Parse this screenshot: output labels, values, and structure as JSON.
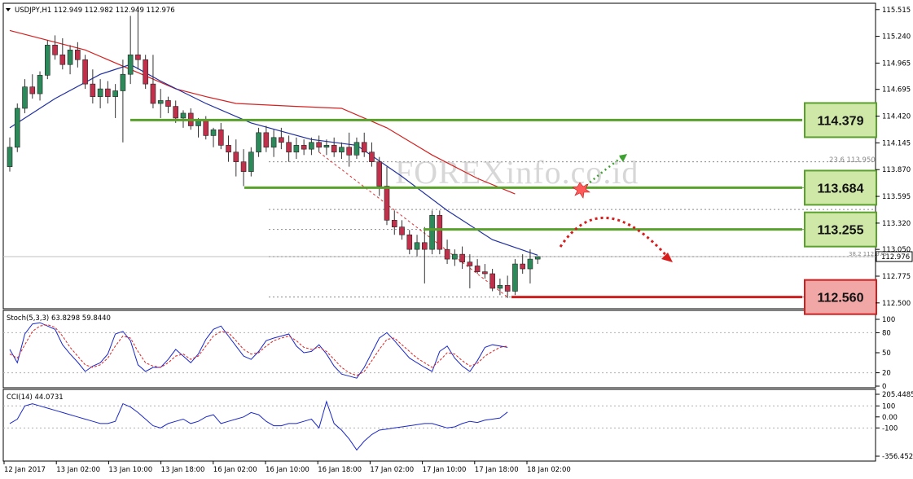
{
  "chart_data": {
    "type": "candlestick",
    "symbol_header": "USDJPY,H1  112.949 112.982 112.949 112.976",
    "price_axis": {
      "ticks": [
        "115.515",
        "115.240",
        "114.965",
        "114.695",
        "114.420",
        "114.145",
        "113.870",
        "113.595",
        "113.320",
        "113.050",
        "112.775",
        "112.500"
      ],
      "min": 112.44,
      "max": 115.58,
      "current_price": "112.976"
    },
    "time_labels": [
      "12 Jan 2017",
      "13 Jan 02:00",
      "13 Jan 10:00",
      "13 Jan 18:00",
      "16 Jan 02:00",
      "16 Jan 10:00",
      "16 Jan 18:00",
      "17 Jan 02:00",
      "17 Jan 10:00",
      "17 Jan 18:00",
      "18 Jan 02:00"
    ],
    "candles": [
      [
        113.9,
        114.2,
        113.85,
        114.1
      ],
      [
        114.1,
        114.55,
        114.05,
        114.5
      ],
      [
        114.5,
        114.8,
        114.45,
        114.72
      ],
      [
        114.72,
        114.85,
        114.6,
        114.65
      ],
      [
        114.65,
        114.88,
        114.58,
        114.84
      ],
      [
        114.84,
        115.2,
        114.8,
        115.15
      ],
      [
        115.15,
        115.25,
        115.0,
        115.05
      ],
      [
        115.05,
        115.22,
        114.9,
        114.95
      ],
      [
        114.95,
        115.15,
        114.85,
        115.1
      ],
      [
        115.1,
        115.18,
        114.92,
        115.0
      ],
      [
        115.0,
        115.05,
        114.7,
        114.75
      ],
      [
        114.75,
        114.9,
        114.55,
        114.62
      ],
      [
        114.62,
        114.8,
        114.5,
        114.7
      ],
      [
        114.7,
        114.78,
        114.55,
        114.62
      ],
      [
        114.62,
        114.75,
        114.4,
        114.68
      ],
      [
        114.68,
        115.0,
        114.15,
        114.85
      ],
      [
        114.85,
        115.45,
        114.75,
        115.05
      ],
      [
        115.05,
        115.55,
        114.9,
        115.0
      ],
      [
        115.0,
        115.05,
        114.7,
        114.75
      ],
      [
        114.75,
        115.05,
        114.5,
        114.55
      ],
      [
        114.55,
        114.7,
        114.4,
        114.58
      ],
      [
        114.58,
        114.62,
        114.45,
        114.52
      ],
      [
        114.52,
        114.58,
        114.35,
        114.4
      ],
      [
        114.4,
        114.48,
        114.3,
        114.45
      ],
      [
        114.45,
        114.5,
        114.28,
        114.32
      ],
      [
        114.32,
        114.4,
        114.2,
        114.38
      ],
      [
        114.38,
        114.42,
        114.18,
        114.22
      ],
      [
        114.22,
        114.3,
        114.1,
        114.28
      ],
      [
        114.28,
        114.35,
        114.08,
        114.12
      ],
      [
        114.12,
        114.22,
        113.95,
        114.05
      ],
      [
        114.05,
        114.18,
        113.8,
        113.95
      ],
      [
        113.95,
        114.08,
        113.7,
        113.85
      ],
      [
        113.85,
        114.1,
        113.8,
        114.05
      ],
      [
        114.05,
        114.3,
        114.0,
        114.25
      ],
      [
        114.25,
        114.32,
        114.05,
        114.1
      ],
      [
        114.1,
        114.28,
        114.0,
        114.2
      ],
      [
        114.2,
        114.3,
        114.08,
        114.15
      ],
      [
        114.15,
        114.22,
        113.95,
        114.05
      ],
      [
        114.05,
        114.2,
        113.98,
        114.12
      ],
      [
        114.12,
        114.18,
        114.02,
        114.08
      ],
      [
        114.08,
        114.2,
        114.02,
        114.15
      ],
      [
        114.15,
        114.22,
        114.05,
        114.1
      ],
      [
        114.1,
        114.18,
        114.02,
        114.12
      ],
      [
        114.12,
        114.2,
        114.0,
        114.05
      ],
      [
        114.05,
        114.15,
        113.98,
        114.1
      ],
      [
        114.1,
        114.25,
        113.9,
        114.02
      ],
      [
        114.02,
        114.2,
        113.98,
        114.15
      ],
      [
        114.15,
        114.25,
        114.0,
        114.05
      ],
      [
        114.05,
        114.15,
        113.9,
        113.95
      ],
      [
        113.95,
        114.0,
        113.6,
        113.7
      ],
      [
        113.7,
        113.9,
        113.3,
        113.35
      ],
      [
        113.35,
        113.45,
        113.2,
        113.28
      ],
      [
        113.28,
        113.35,
        113.15,
        113.2
      ],
      [
        113.2,
        113.25,
        113.0,
        113.05
      ],
      [
        113.05,
        113.2,
        112.98,
        113.12
      ],
      [
        113.12,
        113.28,
        112.7,
        113.05
      ],
      [
        113.05,
        113.45,
        113.0,
        113.4
      ],
      [
        113.4,
        113.45,
        113.0,
        113.05
      ],
      [
        113.05,
        113.15,
        112.9,
        112.95
      ],
      [
        112.95,
        113.05,
        112.88,
        113.0
      ],
      [
        113.0,
        113.08,
        112.85,
        112.92
      ],
      [
        112.92,
        113.0,
        112.65,
        112.88
      ],
      [
        112.88,
        112.95,
        112.8,
        112.82
      ],
      [
        112.82,
        112.9,
        112.75,
        112.8
      ],
      [
        112.8,
        112.85,
        112.62,
        112.65
      ],
      [
        112.65,
        112.75,
        112.58,
        112.68
      ],
      [
        112.68,
        112.78,
        112.55,
        112.62
      ],
      [
        112.62,
        112.95,
        112.58,
        112.9
      ],
      [
        112.9,
        113.0,
        112.8,
        112.85
      ],
      [
        112.85,
        113.05,
        112.7,
        112.95
      ],
      [
        112.95,
        112.98,
        112.9,
        112.976
      ]
    ],
    "ma_slow": [
      [
        0,
        115.3
      ],
      [
        10,
        115.1
      ],
      [
        16,
        114.9
      ],
      [
        22,
        114.7
      ],
      [
        26,
        114.62
      ],
      [
        30,
        114.55
      ],
      [
        38,
        114.52
      ],
      [
        44,
        114.5
      ],
      [
        50,
        114.3
      ],
      [
        56,
        114.02
      ],
      [
        62,
        113.78
      ],
      [
        67,
        113.62
      ]
    ],
    "ma_fast": [
      [
        0,
        114.3
      ],
      [
        6,
        114.6
      ],
      [
        12,
        114.85
      ],
      [
        16,
        114.95
      ],
      [
        20,
        114.78
      ],
      [
        26,
        114.55
      ],
      [
        32,
        114.35
      ],
      [
        40,
        114.18
      ],
      [
        46,
        114.12
      ],
      [
        52,
        113.8
      ],
      [
        58,
        113.45
      ],
      [
        64,
        113.15
      ],
      [
        70,
        112.99
      ]
    ],
    "levels": [
      {
        "price": "114.379",
        "role": "resistance",
        "color": "#7bb040"
      },
      {
        "price": "113.684",
        "role": "resistance",
        "color": "#7bb040"
      },
      {
        "price": "113.255",
        "role": "resistance",
        "color": "#7bb040"
      },
      {
        "price": "112.560",
        "role": "support",
        "color": "#d9534f"
      }
    ],
    "fib_label": "23.6  113.950",
    "fib_small_label": "38.2  112.975",
    "watermark": "FOREXinfo.co.id",
    "stochastic": {
      "label": "Stoch(5,3,3) 63.8298 59.8440",
      "ticks": [
        "100",
        "80",
        "50",
        "20",
        "0"
      ],
      "main": [
        55,
        35,
        78,
        93,
        95,
        90,
        85,
        62,
        48,
        36,
        22,
        30,
        35,
        48,
        78,
        82,
        68,
        32,
        22,
        28,
        28,
        40,
        55,
        45,
        35,
        48,
        70,
        85,
        90,
        75,
        60,
        45,
        40,
        52,
        68,
        72,
        75,
        78,
        60,
        50,
        52,
        62,
        48,
        30,
        18,
        15,
        12,
        28,
        50,
        72,
        80,
        68,
        55,
        42,
        35,
        28,
        22,
        52,
        60,
        42,
        30,
        22,
        38,
        58,
        62,
        60,
        58
      ],
      "signal": [
        48,
        42,
        62,
        82,
        90,
        92,
        88,
        75,
        58,
        45,
        32,
        28,
        32,
        42,
        60,
        75,
        72,
        52,
        35,
        30,
        28,
        35,
        45,
        48,
        40,
        45,
        60,
        75,
        82,
        80,
        68,
        55,
        48,
        50,
        60,
        68,
        72,
        75,
        68,
        58,
        55,
        58,
        52,
        40,
        28,
        20,
        16,
        22,
        38,
        55,
        70,
        72,
        62,
        52,
        42,
        35,
        28,
        38,
        50,
        48,
        38,
        30,
        34,
        45,
        52,
        58,
        60
      ]
    },
    "cci": {
      "label": "CCI(14) 44.0731",
      "ticks": [
        "205.4485",
        "100",
        "0.00",
        "-100",
        "-356.4523"
      ],
      "values": [
        -60,
        -20,
        100,
        120,
        100,
        80,
        60,
        40,
        20,
        0,
        -20,
        -40,
        -60,
        -60,
        -40,
        120,
        90,
        40,
        -20,
        -80,
        -100,
        -60,
        -40,
        -20,
        -60,
        -40,
        0,
        20,
        -60,
        -40,
        -20,
        0,
        40,
        20,
        -40,
        -80,
        -80,
        -60,
        -60,
        -40,
        -20,
        -100,
        140,
        -60,
        -120,
        -200,
        -300,
        -220,
        -160,
        -120,
        -110,
        -100,
        -90,
        -80,
        -70,
        -60,
        -60,
        -80,
        -100,
        -90,
        -60,
        -40,
        -50,
        -30,
        -20,
        -10,
        44
      ]
    }
  }
}
